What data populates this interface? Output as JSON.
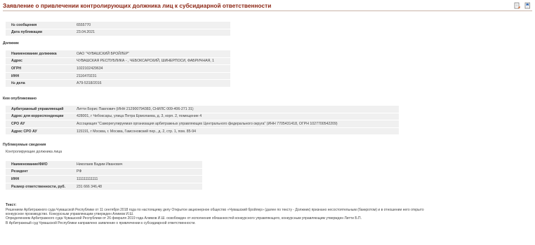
{
  "page": {
    "title": "Заявление о привлечении контролирующих должника лиц к субсидиарной ответственности",
    "icons": [
      "print-icon",
      "bookmark-icon"
    ]
  },
  "message": {
    "rows": [
      {
        "label": "№ сообщения",
        "value": "6555770"
      },
      {
        "label": "Дата публикации",
        "value": "23.04.2021"
      }
    ]
  },
  "debtor": {
    "heading": "Должник",
    "rows": [
      {
        "label": "Наименование должника",
        "value": "ОАО \"ЧУВАШСКИЙ БРОЙЛЕР\""
      },
      {
        "label": "Адрес",
        "value": "ЧУВАШСКАЯ РЕСПУБЛИКА - , ЧЕБОКСАРСКИЙ, ШИНЕРПОСИ, ФАБРИЧНАЯ, 1"
      },
      {
        "label": "ОГРН",
        "value": "1022102429634"
      },
      {
        "label": "ИНН",
        "value": "2116470231"
      },
      {
        "label": "№ дела",
        "value": "А79-5318/2016"
      }
    ]
  },
  "publisher": {
    "heading": "Кем опубликовано",
    "rows": [
      {
        "label": "Арбитражный управляющий",
        "value": "Литти Борис Павлович (ИНН 212900794383,  СНИЛС 009-406-271 31)"
      },
      {
        "label": "Адрес для корреспонденции",
        "value": "428001, г Чебоксары, улица Петра Ермолаева, д. 3, корп. 2, помещение 4"
      },
      {
        "label": "СРО АУ",
        "value": "Ассоциация \"Саморегулируемая организация арбитражных управляющих Центрального федерального округа\" (ИНН 7705431418,  ОГРН 1027700542209)"
      },
      {
        "label": "Адрес СРО АУ",
        "value": "115191, г Москва, г. Москва, Гамсоновский пер., д. 2, стр. 1, пом. 85-94"
      }
    ]
  },
  "details": {
    "heading": "Публикуемые сведения",
    "subheading": "Контролирующие должника лица",
    "rows": [
      {
        "label": "Наименование/ФИО",
        "value": "Николаев Вадим Иванович"
      },
      {
        "label": "Резидент",
        "value": "РФ"
      },
      {
        "label": "ИНН",
        "value": "111111111111"
      },
      {
        "label": "Размер ответственности, руб.",
        "value": "231 666 346,48"
      }
    ]
  },
  "text": {
    "heading": "Текст:",
    "lines": [
      "Решением Арбитражного суда Чувашской Республики от 11 сентября 2018 года по настоящему делу Открытое акционерное общество «Чувашский бройлер» (далее по тексту - Должник) признано несостоятельным (банкротом) и в отношении него открыто",
      "конкурсное производство. Конкурсным управляющим утвержден Алимов И.Ш.",
      "Определением Арбитражного суда Чувашской Республики от 26 февраля 2019 года Алимов И.Ш. освобожден от исполнения обязанностей конкурсного управляющего, конкурсным управляющим утвержден Литти Б.П.",
      "В Арбитражный суд Чувашской Республики направлено заявление о привлечении к субсидиарной ответственности."
    ]
  }
}
